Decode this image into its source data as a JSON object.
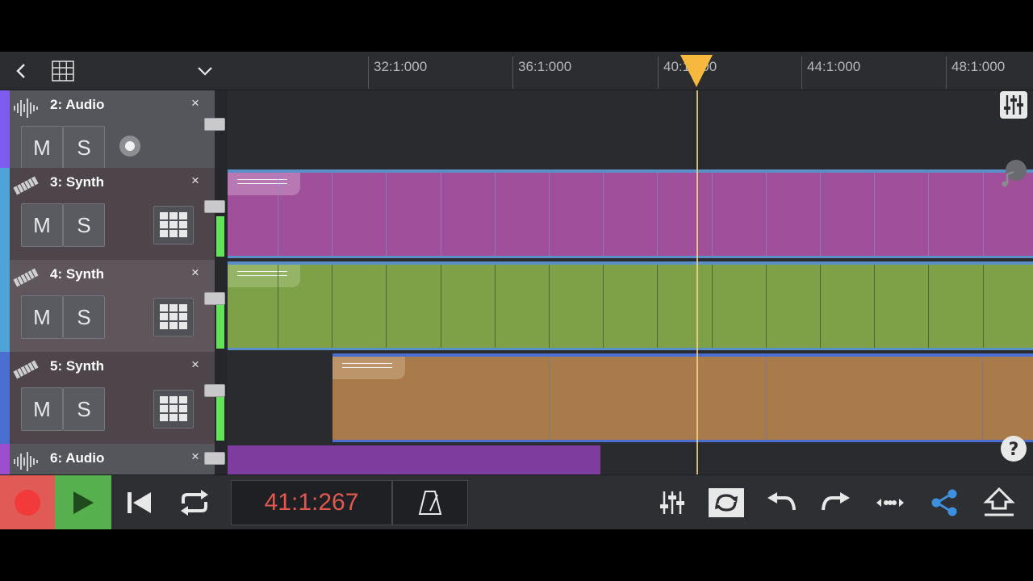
{
  "timeline": {
    "markers": [
      "32:1:000",
      "36:1:000",
      "40:1:000",
      "44:1:000",
      "48:1:000"
    ]
  },
  "tracks": [
    {
      "name": "2: Audio",
      "type": "audio",
      "color": "#7e5cf0"
    },
    {
      "name": "3: Synth",
      "type": "synth",
      "color": "#4ea3d8"
    },
    {
      "name": "4: Synth",
      "type": "synth",
      "color": "#4ea3d8"
    },
    {
      "name": "5: Synth",
      "type": "synth",
      "color": "#4a6fd0"
    },
    {
      "name": "6: Audio",
      "type": "audio",
      "color": "#9b4fd0"
    }
  ],
  "buttons": {
    "mute": "M",
    "solo": "S",
    "close": "×"
  },
  "transport": {
    "time": "41:1:267"
  },
  "colors": {
    "clip_magenta": "#a0509a",
    "clip_green": "#7ea046",
    "clip_orange": "#a97b4a",
    "clip_purple": "#7e3c9e",
    "playhead": "#f6b83d",
    "record": "#e05a56",
    "play": "#56b04e",
    "share": "#3d8fe0"
  }
}
